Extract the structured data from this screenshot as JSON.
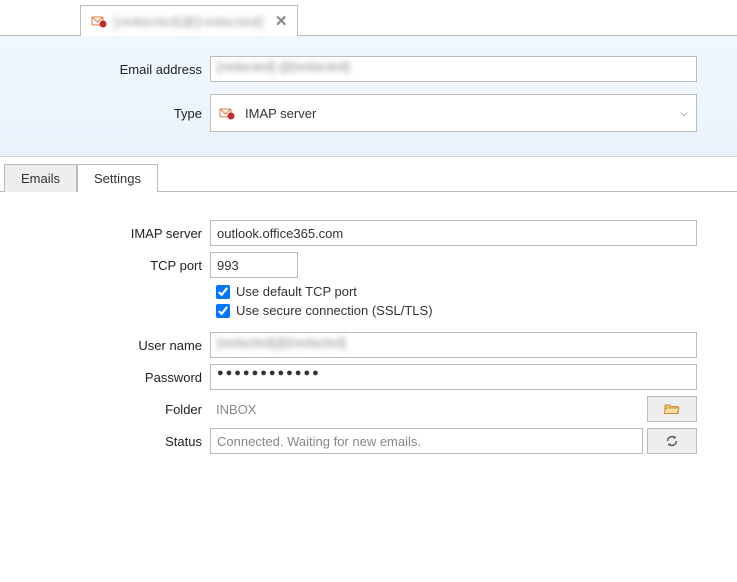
{
  "topTab": {
    "title": "[redacted]@[redacted]",
    "iconName": "mail-icon"
  },
  "header": {
    "emailLabel": "Email address",
    "emailValue": "[redacted] @[redacted]",
    "typeLabel": "Type",
    "typeValue": "IMAP server"
  },
  "tabs": {
    "emails": "Emails",
    "settings": "Settings"
  },
  "settings": {
    "imapServerLabel": "IMAP server",
    "imapServerValue": "outlook.office365.com",
    "tcpPortLabel": "TCP port",
    "tcpPortValue": "993",
    "useDefaultPortLabel": "Use default TCP port",
    "useDefaultPortChecked": true,
    "useSecureLabel": "Use secure connection (SSL/TLS)",
    "useSecureChecked": true,
    "userNameLabel": "User name",
    "userNameValue": "[redacted]@[redacted]",
    "passwordLabel": "Password",
    "passwordValue": "●●●●●●●●●●●●",
    "folderLabel": "Folder",
    "folderValue": "INBOX",
    "statusLabel": "Status",
    "statusValue": "Connected. Waiting for new emails."
  }
}
